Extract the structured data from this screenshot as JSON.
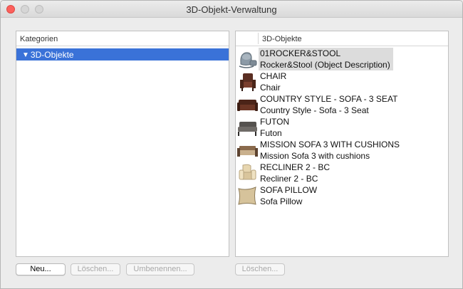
{
  "window": {
    "title": "3D-Objekt-Verwaltung"
  },
  "left_panel": {
    "header": "Kategorien",
    "tree": [
      {
        "label": "3D-Objekte",
        "expanded": true,
        "selected": true
      }
    ]
  },
  "right_panel": {
    "header": "3D-Objekte",
    "items": [
      {
        "name": "01ROCKER&STOOL",
        "description": "Rocker&Stool (Object Description)",
        "icon": "rocker-stool-icon",
        "selected": true
      },
      {
        "name": "CHAIR",
        "description": "Chair",
        "icon": "chair-icon"
      },
      {
        "name": "COUNTRY STYLE - SOFA - 3 SEAT",
        "description": "Country Style - Sofa - 3 Seat",
        "icon": "country-sofa-icon"
      },
      {
        "name": "FUTON",
        "description": "Futon",
        "icon": "futon-icon"
      },
      {
        "name": "MISSION SOFA 3 WITH CUSHIONS",
        "description": "Mission Sofa 3 with cushions",
        "icon": "mission-sofa-icon"
      },
      {
        "name": "RECLINER 2 - BC",
        "description": "Recliner 2 - BC",
        "icon": "recliner-icon"
      },
      {
        "name": "SOFA PILLOW",
        "description": "Sofa Pillow",
        "icon": "sofa-pillow-icon"
      }
    ]
  },
  "buttons": {
    "new": "Neu...",
    "delete_left": "Löschen...",
    "rename": "Umbenennen...",
    "delete_right": "Löschen..."
  },
  "colors": {
    "selection": "#3a72d8",
    "close": "#fc605c"
  }
}
